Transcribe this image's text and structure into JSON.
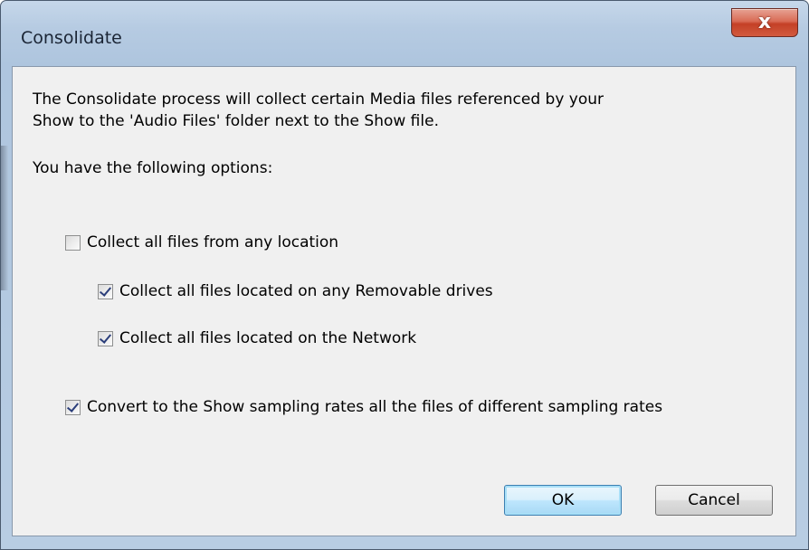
{
  "window": {
    "title": "Consolidate",
    "close_glyph": "x"
  },
  "message": {
    "line1": "The Consolidate process will collect certain Media files referenced by your",
    "line2": "Show to the 'Audio Files' folder next to the Show file.",
    "options_intro": "You have the following options:"
  },
  "options": {
    "collect_any": {
      "label": "Collect all files from any location",
      "checked": false
    },
    "collect_removable": {
      "label": "Collect all files located on any Removable drives",
      "checked": true
    },
    "collect_network": {
      "label": "Collect all files located on the Network",
      "checked": true
    },
    "convert_rates": {
      "label": "Convert to the Show sampling rates all the files of different sampling rates",
      "checked": true
    }
  },
  "buttons": {
    "ok": "OK",
    "cancel": "Cancel"
  },
  "colors": {
    "frame": "#b6cbe2",
    "content_bg": "#f0f0f0",
    "close_red": "#c44026",
    "default_button_border": "#3c7fb1"
  }
}
